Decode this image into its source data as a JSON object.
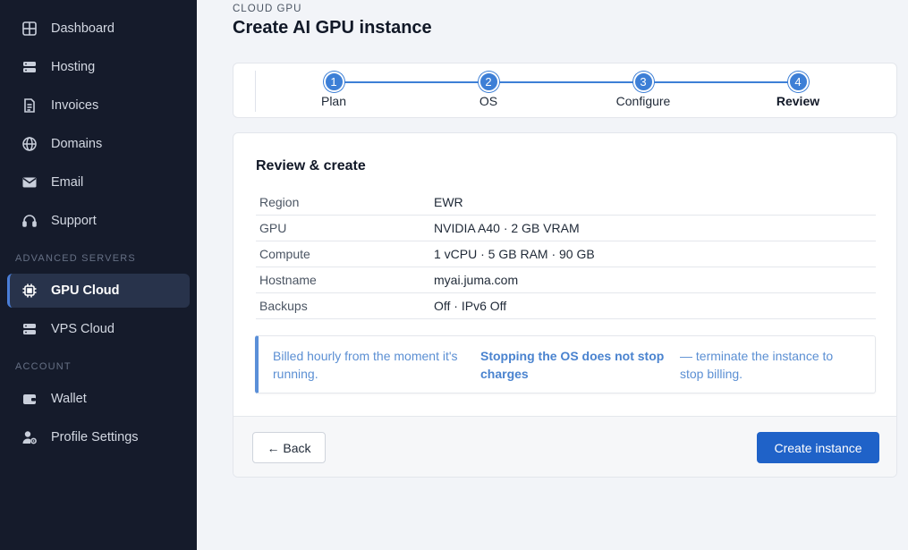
{
  "sidebar": {
    "items_top": [
      {
        "label": "Dashboard",
        "icon": "dashboard-icon"
      },
      {
        "label": "Hosting",
        "icon": "server-icon"
      },
      {
        "label": "Invoices",
        "icon": "invoice-icon"
      },
      {
        "label": "Domains",
        "icon": "globe-icon"
      },
      {
        "label": "Email",
        "icon": "mail-icon"
      },
      {
        "label": "Support",
        "icon": "headset-icon"
      }
    ],
    "section_advanced": "ADVANCED SERVERS",
    "items_advanced": [
      {
        "label": "GPU Cloud",
        "icon": "chip-icon",
        "active": true
      },
      {
        "label": "VPS Cloud",
        "icon": "server-icon"
      }
    ],
    "section_account": "ACCOUNT",
    "items_account": [
      {
        "label": "Wallet",
        "icon": "wallet-icon"
      },
      {
        "label": "Profile Settings",
        "icon": "user-gear-icon"
      }
    ]
  },
  "header": {
    "eyebrow": "CLOUD GPU",
    "title": "Create AI GPU instance"
  },
  "stepper": {
    "steps": [
      {
        "number": "1",
        "label": "Plan"
      },
      {
        "number": "2",
        "label": "OS"
      },
      {
        "number": "3",
        "label": "Configure"
      },
      {
        "number": "4",
        "label": "Review"
      }
    ],
    "current_step": 4
  },
  "review": {
    "title": "Review & create",
    "rows": [
      {
        "key": "Region",
        "value": "EWR"
      },
      {
        "key": "GPU",
        "value": "NVIDIA A40 · 2 GB VRAM"
      },
      {
        "key": "Compute",
        "value": "1 vCPU · 5 GB RAM · 90 GB"
      },
      {
        "key": "Hostname",
        "value": "myai.juma.com"
      },
      {
        "key": "Backups",
        "value": "Off · IPv6 Off"
      }
    ],
    "notice": {
      "part1": "Billed hourly from the moment it's running.",
      "part2": "Stopping the OS does not stop charges",
      "part3": "— terminate the instance to stop billing."
    }
  },
  "footer": {
    "back_label": "← Back",
    "create_label": "Create instance"
  },
  "colors": {
    "sidebar_bg": "#151b2b",
    "accent": "#3d7fd6",
    "primary_button": "#1f62c8"
  }
}
